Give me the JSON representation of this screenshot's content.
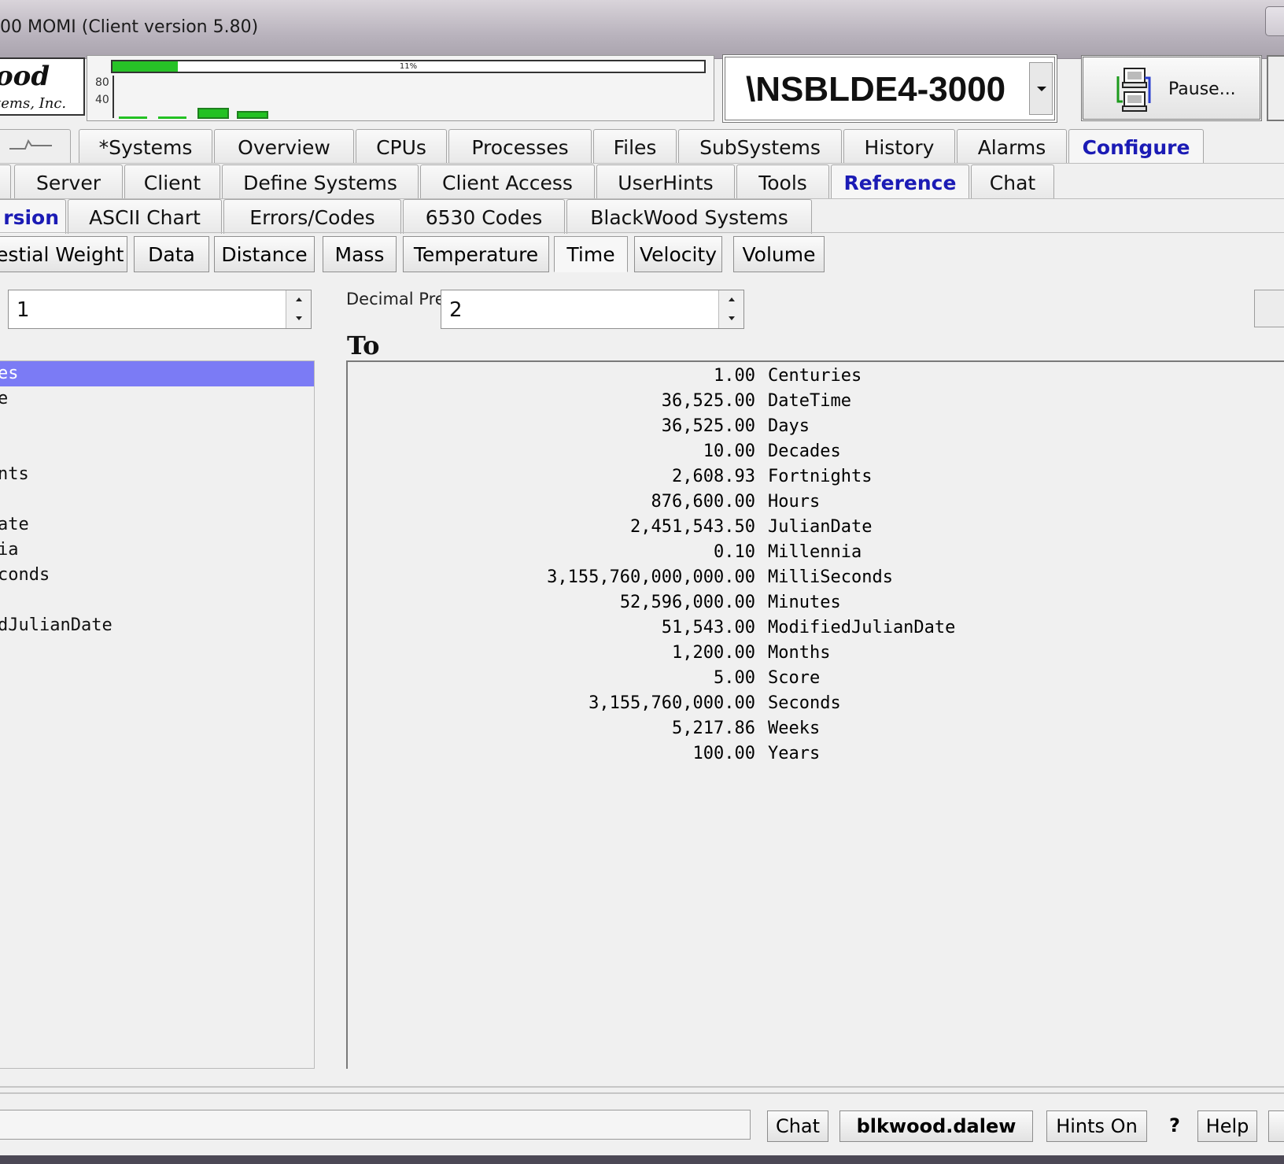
{
  "window": {
    "title": "00 MOMI (Client version 5.80)"
  },
  "logo": {
    "line1": "ood",
    "line2": "tems, Inc."
  },
  "perf": {
    "cpu_percent_label": "11%",
    "cpu_fill": 0.11,
    "y_labels": [
      "80",
      "40"
    ]
  },
  "system": {
    "name": "\\NSBLDE4-3000"
  },
  "pause_button": {
    "label": "Pause..."
  },
  "tabs_row1": [
    "*Systems",
    "Overview",
    "CPUs",
    "Processes",
    "Files",
    "SubSystems",
    "History",
    "Alarms",
    "Configure"
  ],
  "tabs_row2": [
    "Server",
    "Client",
    "Define Systems",
    "Client Access",
    "UserHints",
    "Tools",
    "Reference",
    "Chat"
  ],
  "tabs_row3": [
    "rsion",
    "ASCII Chart",
    "Errors/Codes",
    "6530 Codes",
    "BlackWood Systems"
  ],
  "subtabs": [
    "estial Weight",
    "Data",
    "Distance",
    "Mass",
    "Temperature",
    "Time",
    "Velocity",
    "Volume"
  ],
  "inputs": {
    "from_value": "1",
    "decimal_precision_label": "Decimal Precision",
    "decimal_precision_value": "2"
  },
  "to_label": "To",
  "from_list": [
    "es",
    "e",
    "",
    "",
    "nts",
    "",
    "ate",
    "ia",
    "conds",
    "",
    "dJulianDate"
  ],
  "conversions": [
    {
      "value": "1.00",
      "unit": "Centuries"
    },
    {
      "value": "36,525.00",
      "unit": "DateTime"
    },
    {
      "value": "36,525.00",
      "unit": "Days"
    },
    {
      "value": "10.00",
      "unit": "Decades"
    },
    {
      "value": "2,608.93",
      "unit": "Fortnights"
    },
    {
      "value": "876,600.00",
      "unit": "Hours"
    },
    {
      "value": "2,451,543.50",
      "unit": "JulianDate"
    },
    {
      "value": "0.10",
      "unit": "Millennia"
    },
    {
      "value": "3,155,760,000,000.00",
      "unit": "MilliSeconds"
    },
    {
      "value": "52,596,000.00",
      "unit": "Minutes"
    },
    {
      "value": "51,543.00",
      "unit": "ModifiedJulianDate"
    },
    {
      "value": "1,200.00",
      "unit": "Months"
    },
    {
      "value": "5.00",
      "unit": "Score"
    },
    {
      "value": "3,155,760,000.00",
      "unit": "Seconds"
    },
    {
      "value": "5,217.86",
      "unit": "Weeks"
    },
    {
      "value": "100.00",
      "unit": "Years"
    }
  ],
  "statusbar": {
    "chat": "Chat",
    "user": "blkwood.dalew",
    "hints": "Hints On",
    "question": "?",
    "help": "Help"
  }
}
